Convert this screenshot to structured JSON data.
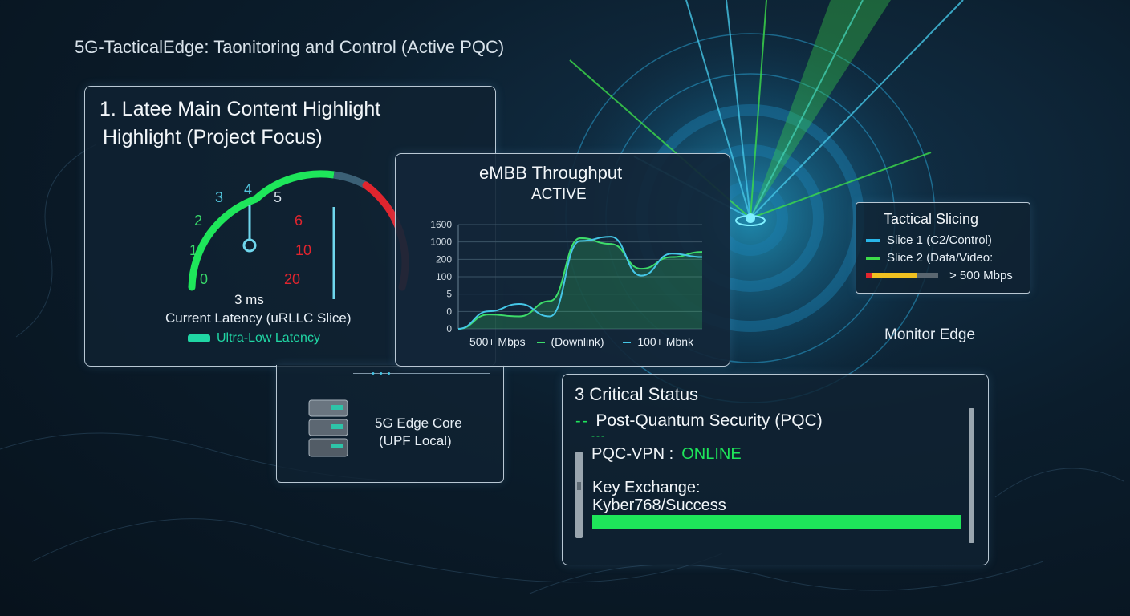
{
  "header": {
    "title": "5G-TacticalEdge: Taonitoring and Control (Active PQC)"
  },
  "latency_panel": {
    "heading_line1": "1. Latee Main Content Highlight",
    "heading_line2": "Highlight (Project Focus)",
    "gauge": {
      "ticks": [
        "0",
        "1",
        "2",
        "3",
        "4",
        "5",
        "6",
        "10",
        "20"
      ],
      "value_ms": 3,
      "value_label": "3 ms",
      "caption": "Current Latency (uRLLC Slice)",
      "badge": "Ultra-Low Latency"
    }
  },
  "throughput_panel": {
    "title": "eMBB Throughput",
    "status": "ACTIVE",
    "chart_data": {
      "type": "line",
      "y_tick_labels": [
        "1600",
        "1000",
        "200",
        "100",
        "5",
        "0",
        "0"
      ],
      "series": [
        {
          "name": "(Downlink)",
          "color": "#3ddc6a",
          "values": [
            0,
            40,
            30,
            150,
            1600,
            1400,
            700,
            1000,
            1150
          ]
        },
        {
          "name": "100+ Mbnk",
          "color": "#45c6e6",
          "values": [
            0,
            60,
            120,
            30,
            1500,
            1650,
            550,
            1100,
            1000
          ]
        }
      ],
      "legend": [
        "500+ Mbps",
        "(Downlink)",
        "100+ Mbnk"
      ]
    }
  },
  "edge_core_panel": {
    "line1": "5G Edge Core",
    "line2": "(UPF Local)"
  },
  "slicing_panel": {
    "title": "Tactical Slicing",
    "slice1": "Slice 1 (C2/Control)",
    "slice2": "Slice 2 (Data/Video:",
    "bandwidth": "> 500 Mbps",
    "colors": {
      "slice1": "#29b6e8",
      "slice2": "#3ddc4a"
    }
  },
  "monitor_label": "Monitor Edge",
  "status_panel": {
    "title": "3 Critical Status",
    "subtitle": "Post-Quantum Security (PQC)",
    "vpn_label": "PQC-VPN :",
    "vpn_value": "ONLINE",
    "key_exchange_label": "Key Exchange:",
    "key_exchange_value": "Kyber768/Success",
    "progress": 1.0
  },
  "colors": {
    "green": "#1ee65a",
    "cyan": "#3ecbe0",
    "red": "#e0252e",
    "panel_border": "#b9c8d4"
  }
}
